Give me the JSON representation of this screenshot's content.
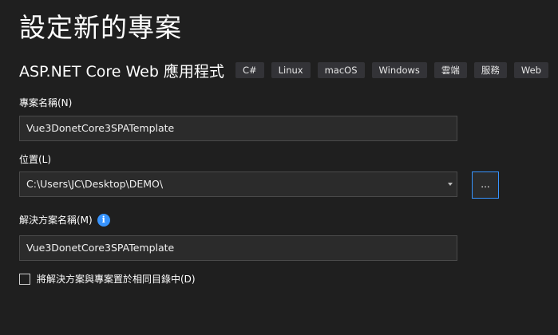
{
  "page": {
    "title": "設定新的專案"
  },
  "template": {
    "name": "ASP.NET Core Web 應用程式",
    "tags": [
      "C#",
      "Linux",
      "macOS",
      "Windows",
      "雲端",
      "服務",
      "Web"
    ]
  },
  "project_name": {
    "label": "專案名稱(N)",
    "value": "Vue3DonetCore3SPATemplate"
  },
  "location": {
    "label": "位置(L)",
    "value": "C:\\Users\\JC\\Desktop\\DEMO\\",
    "browse_label": "..."
  },
  "solution_name": {
    "label": "解決方案名稱(M)",
    "info_glyph": "i",
    "value": "Vue3DonetCore3SPATemplate"
  },
  "same_directory": {
    "label": "將解決方案與專案置於相同目錄中(D)",
    "checked": false
  },
  "colors": {
    "background": "#1f1f1f",
    "accent": "#3794ff",
    "tag_background": "#333337",
    "input_background": "#2b2b2b"
  }
}
